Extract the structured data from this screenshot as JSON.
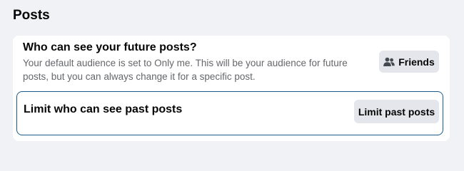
{
  "section": {
    "title": "Posts"
  },
  "future_posts": {
    "title": "Who can see your future posts?",
    "description": "Your default audience is set to Only me. This will be your audience for future posts, but you can always change it for a specific post.",
    "audience_button": {
      "label": "Friends",
      "icon": "friends-icon"
    }
  },
  "past_posts": {
    "title": "Limit who can see past posts",
    "button_label": "Limit past posts"
  },
  "colors": {
    "background": "#f0f2f5",
    "card": "#ffffff",
    "button": "#e4e6eb",
    "focus_border": "#1b5a8c",
    "secondary_text": "#65676b"
  }
}
